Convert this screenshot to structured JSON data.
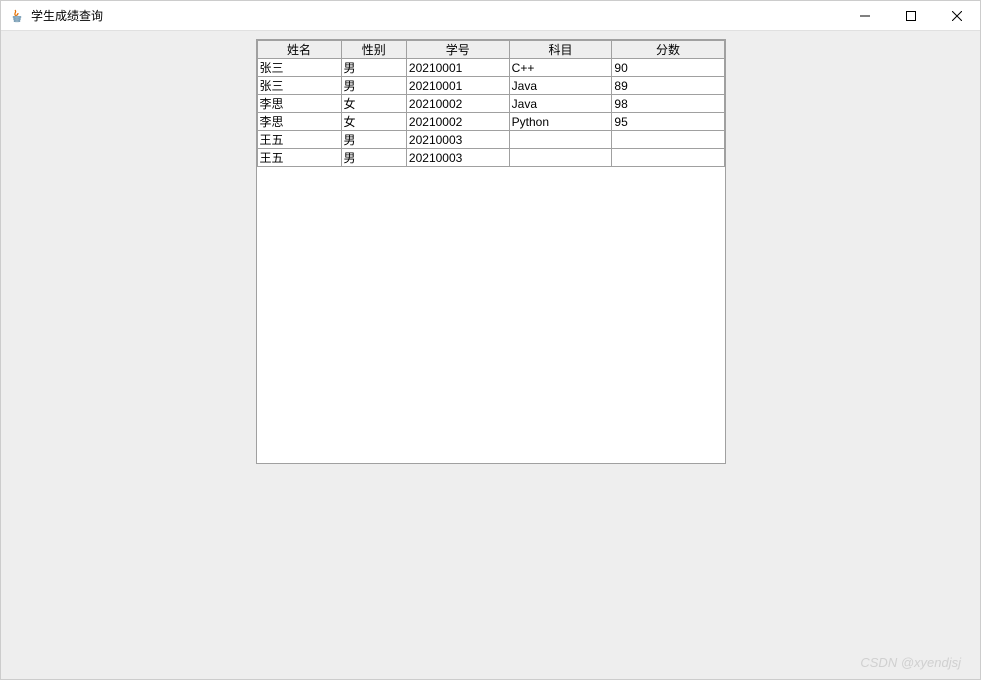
{
  "window": {
    "title": "学生成绩查询"
  },
  "table": {
    "headers": [
      "姓名",
      "性别",
      "学号",
      "科目",
      "分数"
    ],
    "rows": [
      {
        "name": "张三",
        "gender": "男",
        "id": "20210001",
        "subject": "C++",
        "score": "90"
      },
      {
        "name": "张三",
        "gender": "男",
        "id": "20210001",
        "subject": "Java",
        "score": "89"
      },
      {
        "name": "李思",
        "gender": "女",
        "id": "20210002",
        "subject": "Java",
        "score": "98"
      },
      {
        "name": "李思",
        "gender": "女",
        "id": "20210002",
        "subject": "Python",
        "score": "95"
      },
      {
        "name": "王五",
        "gender": "男",
        "id": "20210003",
        "subject": "",
        "score": ""
      },
      {
        "name": "王五",
        "gender": "男",
        "id": "20210003",
        "subject": "",
        "score": ""
      }
    ]
  },
  "watermark": "CSDN @xyendjsj"
}
